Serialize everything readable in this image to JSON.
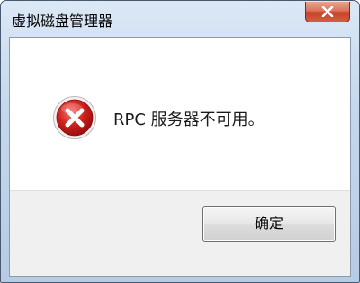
{
  "window": {
    "title": "虚拟磁盘管理器"
  },
  "dialog": {
    "message": "RPC 服务器不可用。",
    "icon": "error-icon",
    "ok_label": "确定"
  },
  "colors": {
    "title_bar": "#c4d7ec",
    "close_button": "#c5432a",
    "error_red": "#c8141e"
  }
}
